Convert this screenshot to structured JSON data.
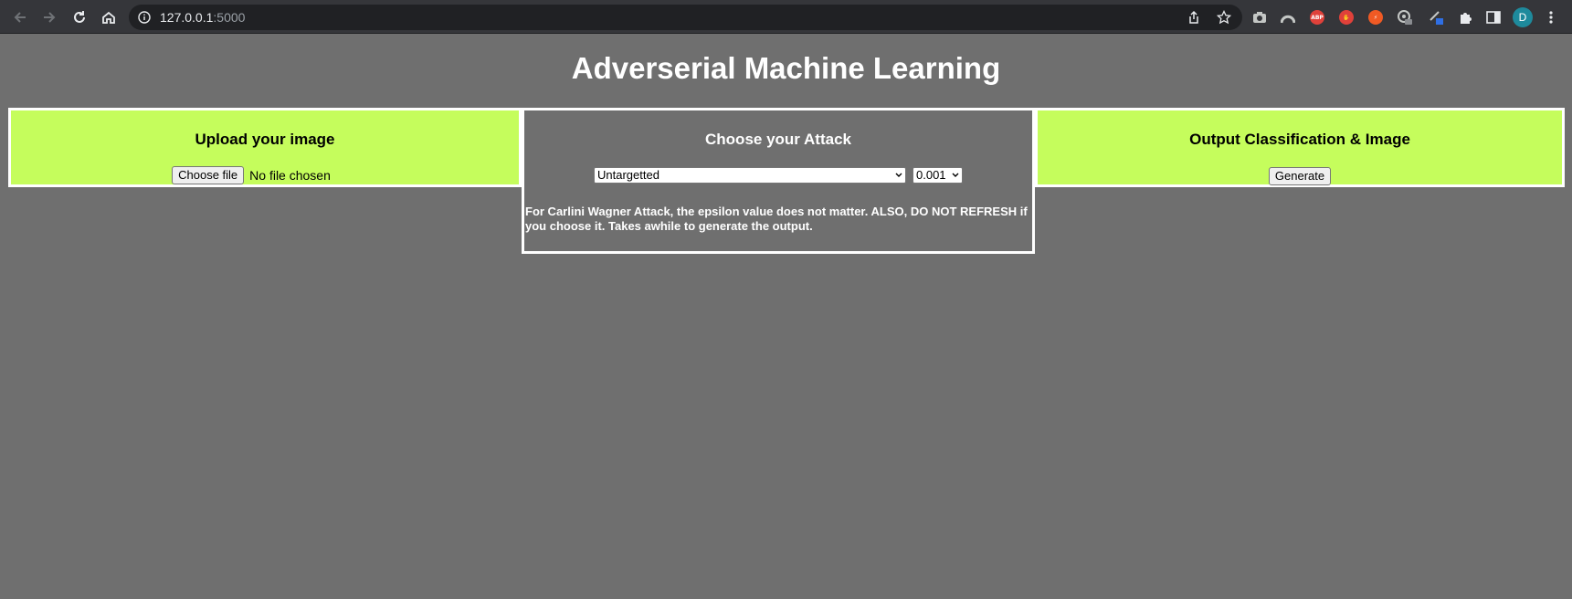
{
  "browser": {
    "url_host": "127.0.0.1",
    "url_port": ":5000",
    "profile_initial": "D",
    "extensions": [
      "camera-icon",
      "arc-icon",
      "adblock-icon",
      "hand-icon",
      "spark-icon",
      "radar-icon",
      "pen-icon",
      "puzzle-icon",
      "sidebar-icon"
    ]
  },
  "page": {
    "title": "Adverserial Machine Learning"
  },
  "upload": {
    "heading": "Upload your image",
    "choose_button": "Choose file",
    "status": "No file chosen"
  },
  "attack": {
    "heading": "Choose your Attack",
    "attack_selected": "Untargetted",
    "epsilon_selected": "0.001",
    "note": "For Carlini Wagner Attack, the epsilon value does not matter. ALSO, DO NOT REFRESH if you choose it. Takes awhile to generate the output."
  },
  "output": {
    "heading": "Output Classification & Image",
    "generate_button": "Generate"
  },
  "colors": {
    "page_bg": "#6f6f6f",
    "panel_green": "#c5fd5c",
    "border": "#ffffff"
  }
}
